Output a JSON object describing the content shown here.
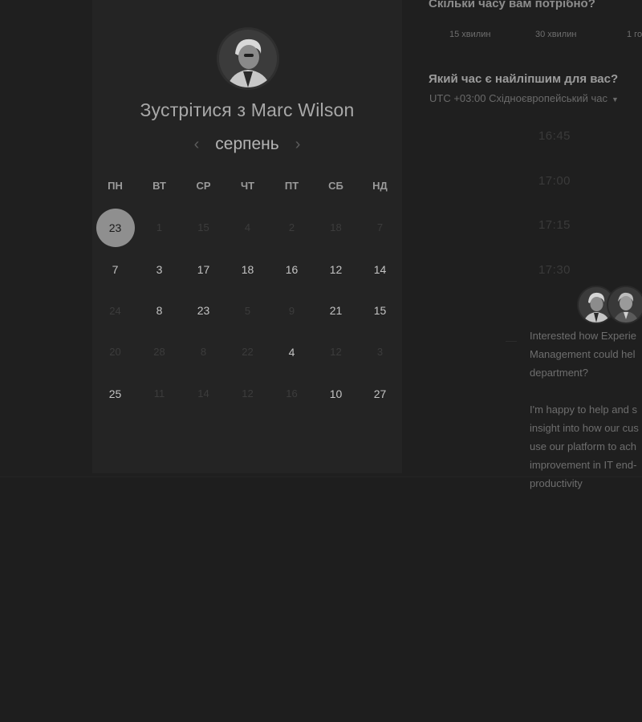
{
  "meeting": {
    "title": "Зустрітися з Marc Wilson",
    "host_avatar": "person-photo-icon"
  },
  "calendar": {
    "month": "серпень",
    "prev_icon": "chevron-left-icon",
    "next_icon": "chevron-right-icon",
    "weekdays": [
      "ПН",
      "ВТ",
      "СР",
      "ЧТ",
      "ПТ",
      "СБ",
      "НД"
    ],
    "weeks": [
      [
        "23",
        "1",
        "15",
        "4",
        "2",
        "18",
        "7"
      ],
      [
        "7",
        "3",
        "17",
        "18",
        "16",
        "12",
        "14"
      ],
      [
        "24",
        "8",
        "23",
        "5",
        "9",
        "21",
        "15"
      ],
      [
        "20",
        "28",
        "8",
        "22",
        "4",
        "12",
        "3"
      ],
      [
        "25",
        "11",
        "14",
        "12",
        "16",
        "10",
        "27"
      ]
    ],
    "available": [
      [
        true,
        false,
        false,
        false,
        false,
        false,
        false
      ],
      [
        true,
        true,
        true,
        true,
        true,
        true,
        true
      ],
      [
        false,
        true,
        true,
        false,
        false,
        true,
        true
      ],
      [
        false,
        false,
        false,
        false,
        true,
        false,
        false
      ],
      [
        true,
        false,
        false,
        false,
        false,
        true,
        true
      ]
    ],
    "selected": {
      "week": 0,
      "day": 0
    }
  },
  "duration": {
    "question": "Скільки часу вам потрібно?",
    "options": [
      "15 хвилин",
      "30 хвилин",
      "1 го"
    ]
  },
  "time": {
    "question": "Який час є найліпшим для вас?",
    "timezone": "UTC +03:00 Східноєвропейський час",
    "timezone_icon": "caret-down-icon",
    "slots": [
      "16:45",
      "17:00",
      "17:15",
      "17:30"
    ]
  },
  "chat": {
    "message": "Interested how Experie\nManagement could hel\ndepartment?\n\nI'm happy to help and s\ninsight into how our cus\nuse our platform to ach\nimprovement in IT end-\nproductivity"
  }
}
